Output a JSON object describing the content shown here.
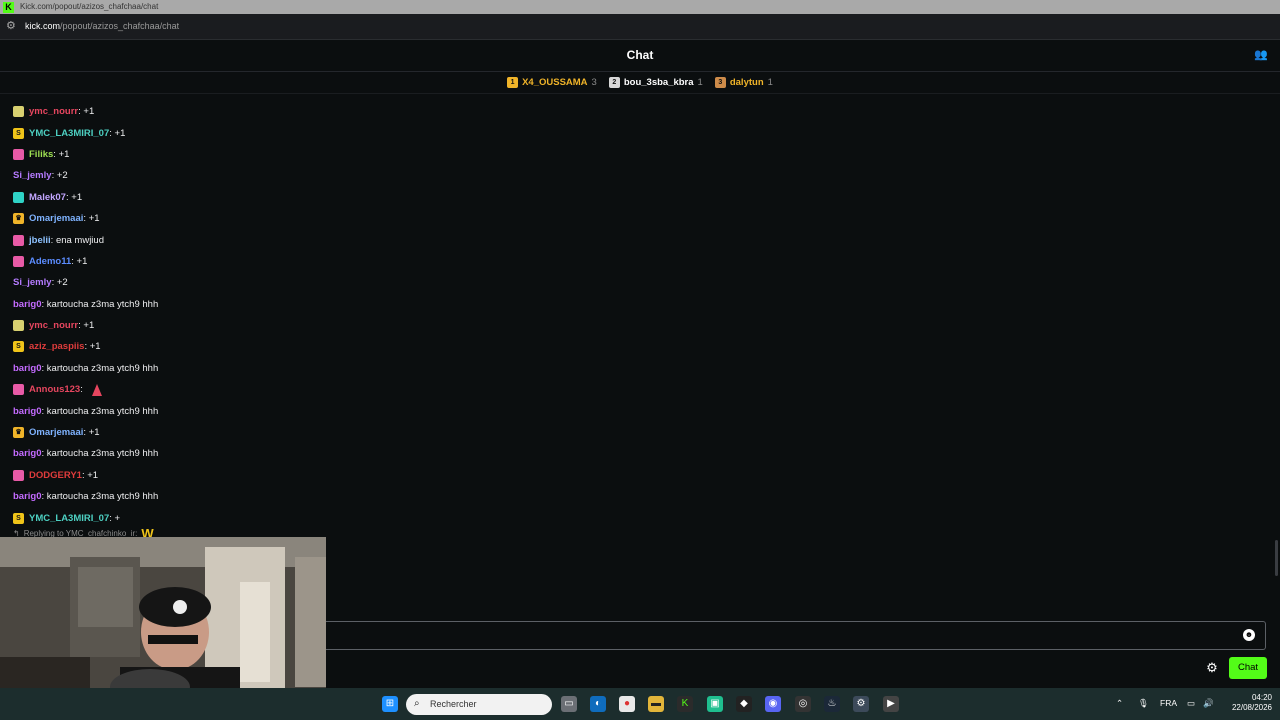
{
  "browser": {
    "tab_title": "Kick.com/popout/azizos_chafchaa/chat",
    "url_host": "kick.com",
    "url_path": "/popout/azizos_chafchaa/chat"
  },
  "chat": {
    "title": "Chat",
    "input_placeholder": "",
    "send_label": "Chat"
  },
  "leaderboard": [
    {
      "name": "X4_OUSSAMA",
      "count": "3",
      "medal_color": "#f0b429",
      "name_color": "#f0b429"
    },
    {
      "name": "bou_3sba_kbra",
      "count": "1",
      "medal_color": "#d8d8d8",
      "name_color": "#ffffff"
    },
    {
      "name": "dalytun",
      "count": "1",
      "medal_color": "#cd8b4a",
      "name_color": "#f0b429"
    }
  ],
  "messages": [
    {
      "user": "ymc_nourr",
      "sep": ": ",
      "text": "+1",
      "color": "#e6465f",
      "badge": "avatar"
    },
    {
      "user": "YMC_LA3MIRI_07",
      "sep": ": ",
      "text": "+1",
      "color": "#4dd0c2",
      "badge": "sub-yellow"
    },
    {
      "user": "Filiks",
      "sep": ": ",
      "text": "+1",
      "color": "#9ee052",
      "badge": "pink"
    },
    {
      "user": "Si_jemly",
      "sep": ": ",
      "text": "+2",
      "color": "#b57bff",
      "badge": ""
    },
    {
      "user": "Malek07",
      "sep": ": ",
      "text": "+1",
      "color": "#c3a6ff",
      "badge": "cyan"
    },
    {
      "user": "Omarjemaai",
      "sep": ": ",
      "text": "+1",
      "color": "#7fb3ff",
      "badge": "crown"
    },
    {
      "user": "jbelii",
      "sep": ": ",
      "text": "ena mwjiud",
      "color": "#8ec2ff",
      "badge": "pink"
    },
    {
      "user": "Ademo11",
      "sep": ": ",
      "text": "+1",
      "color": "#5b8cff",
      "badge": "pink"
    },
    {
      "user": "Si_jemly",
      "sep": ": ",
      "text": "+2",
      "color": "#b57bff",
      "badge": ""
    },
    {
      "user": "barig0",
      "sep": ": ",
      "text": "kartoucha z3ma ytch9 hhh",
      "color": "#c46bff",
      "badge": ""
    },
    {
      "user": "ymc_nourr",
      "sep": ": ",
      "text": "+1",
      "color": "#e6465f",
      "badge": "avatar"
    },
    {
      "user": "aziz_paspiis",
      "sep": ": ",
      "text": "+1",
      "color": "#e03c3c",
      "badge": "sub-yellow"
    },
    {
      "user": "barig0",
      "sep": ": ",
      "text": "kartoucha z3ma ytch9 hhh",
      "color": "#c46bff",
      "badge": ""
    },
    {
      "user": "Annous123",
      "sep": ": ",
      "text": "",
      "color": "#e6465f",
      "badge": "pink",
      "emote": true
    },
    {
      "user": "barig0",
      "sep": ": ",
      "text": "kartoucha z3ma ytch9 hhh",
      "color": "#c46bff",
      "badge": ""
    },
    {
      "user": "Omarjemaai",
      "sep": ": ",
      "text": "+1",
      "color": "#7fb3ff",
      "badge": "crown"
    },
    {
      "user": "barig0",
      "sep": ": ",
      "text": "kartoucha z3ma ytch9 hhh",
      "color": "#c46bff",
      "badge": ""
    },
    {
      "user": "DODGERY1",
      "sep": ": ",
      "text": "+1",
      "color": "#e03c3c",
      "badge": "pink"
    },
    {
      "user": "barig0",
      "sep": ": ",
      "text": "kartoucha z3ma ytch9 hhh",
      "color": "#c46bff",
      "badge": ""
    },
    {
      "user": "YMC_LA3MIRI_07",
      "sep": ": ",
      "text": "+",
      "color": "#4dd0c2",
      "badge": "sub-yellow"
    }
  ],
  "reply": {
    "label": "Replying to YMC_chafchinko_ir:",
    "emote": "W"
  },
  "taskbar": {
    "search_placeholder": "Rechercher",
    "language": "FRA",
    "time": "04:20",
    "date": "22/08/2026"
  }
}
